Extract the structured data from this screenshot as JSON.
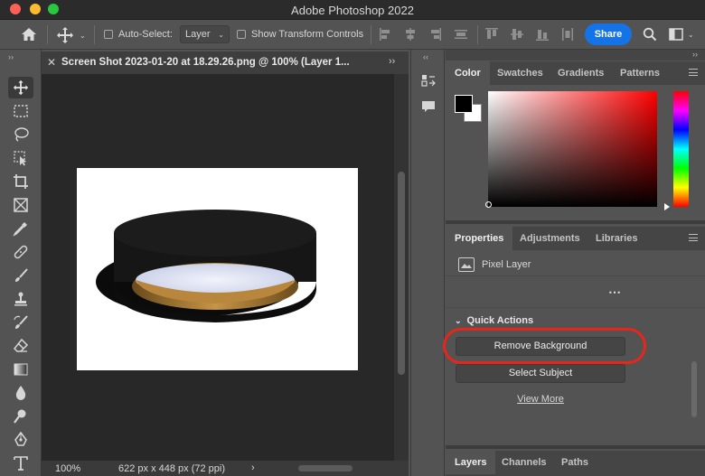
{
  "window": {
    "title": "Adobe Photoshop 2022"
  },
  "options_bar": {
    "auto_select_label": "Auto-Select:",
    "auto_select_value": "Layer",
    "show_transform_label": "Show Transform Controls",
    "share_label": "Share"
  },
  "document": {
    "tab_title": "Screen Shot 2023-01-20 at 18.29.26.png @ 100% (Layer 1...",
    "zoom": "100%",
    "dimensions": "622 px x 448 px (72 ppi)"
  },
  "color_panel": {
    "tabs": [
      "Color",
      "Swatches",
      "Gradients",
      "Patterns"
    ],
    "foreground": "#000000",
    "background": "#ffffff"
  },
  "properties_panel": {
    "tabs": [
      "Properties",
      "Adjustments",
      "Libraries"
    ],
    "layer_type": "Pixel Layer",
    "quick_actions_title": "Quick Actions",
    "remove_background": "Remove Background",
    "select_subject": "Select Subject",
    "view_more": "View More"
  },
  "layers_panel": {
    "tabs": [
      "Layers",
      "Channels",
      "Paths"
    ]
  },
  "colors": {
    "accent": "#1473e6",
    "highlight": "#e8251b"
  }
}
